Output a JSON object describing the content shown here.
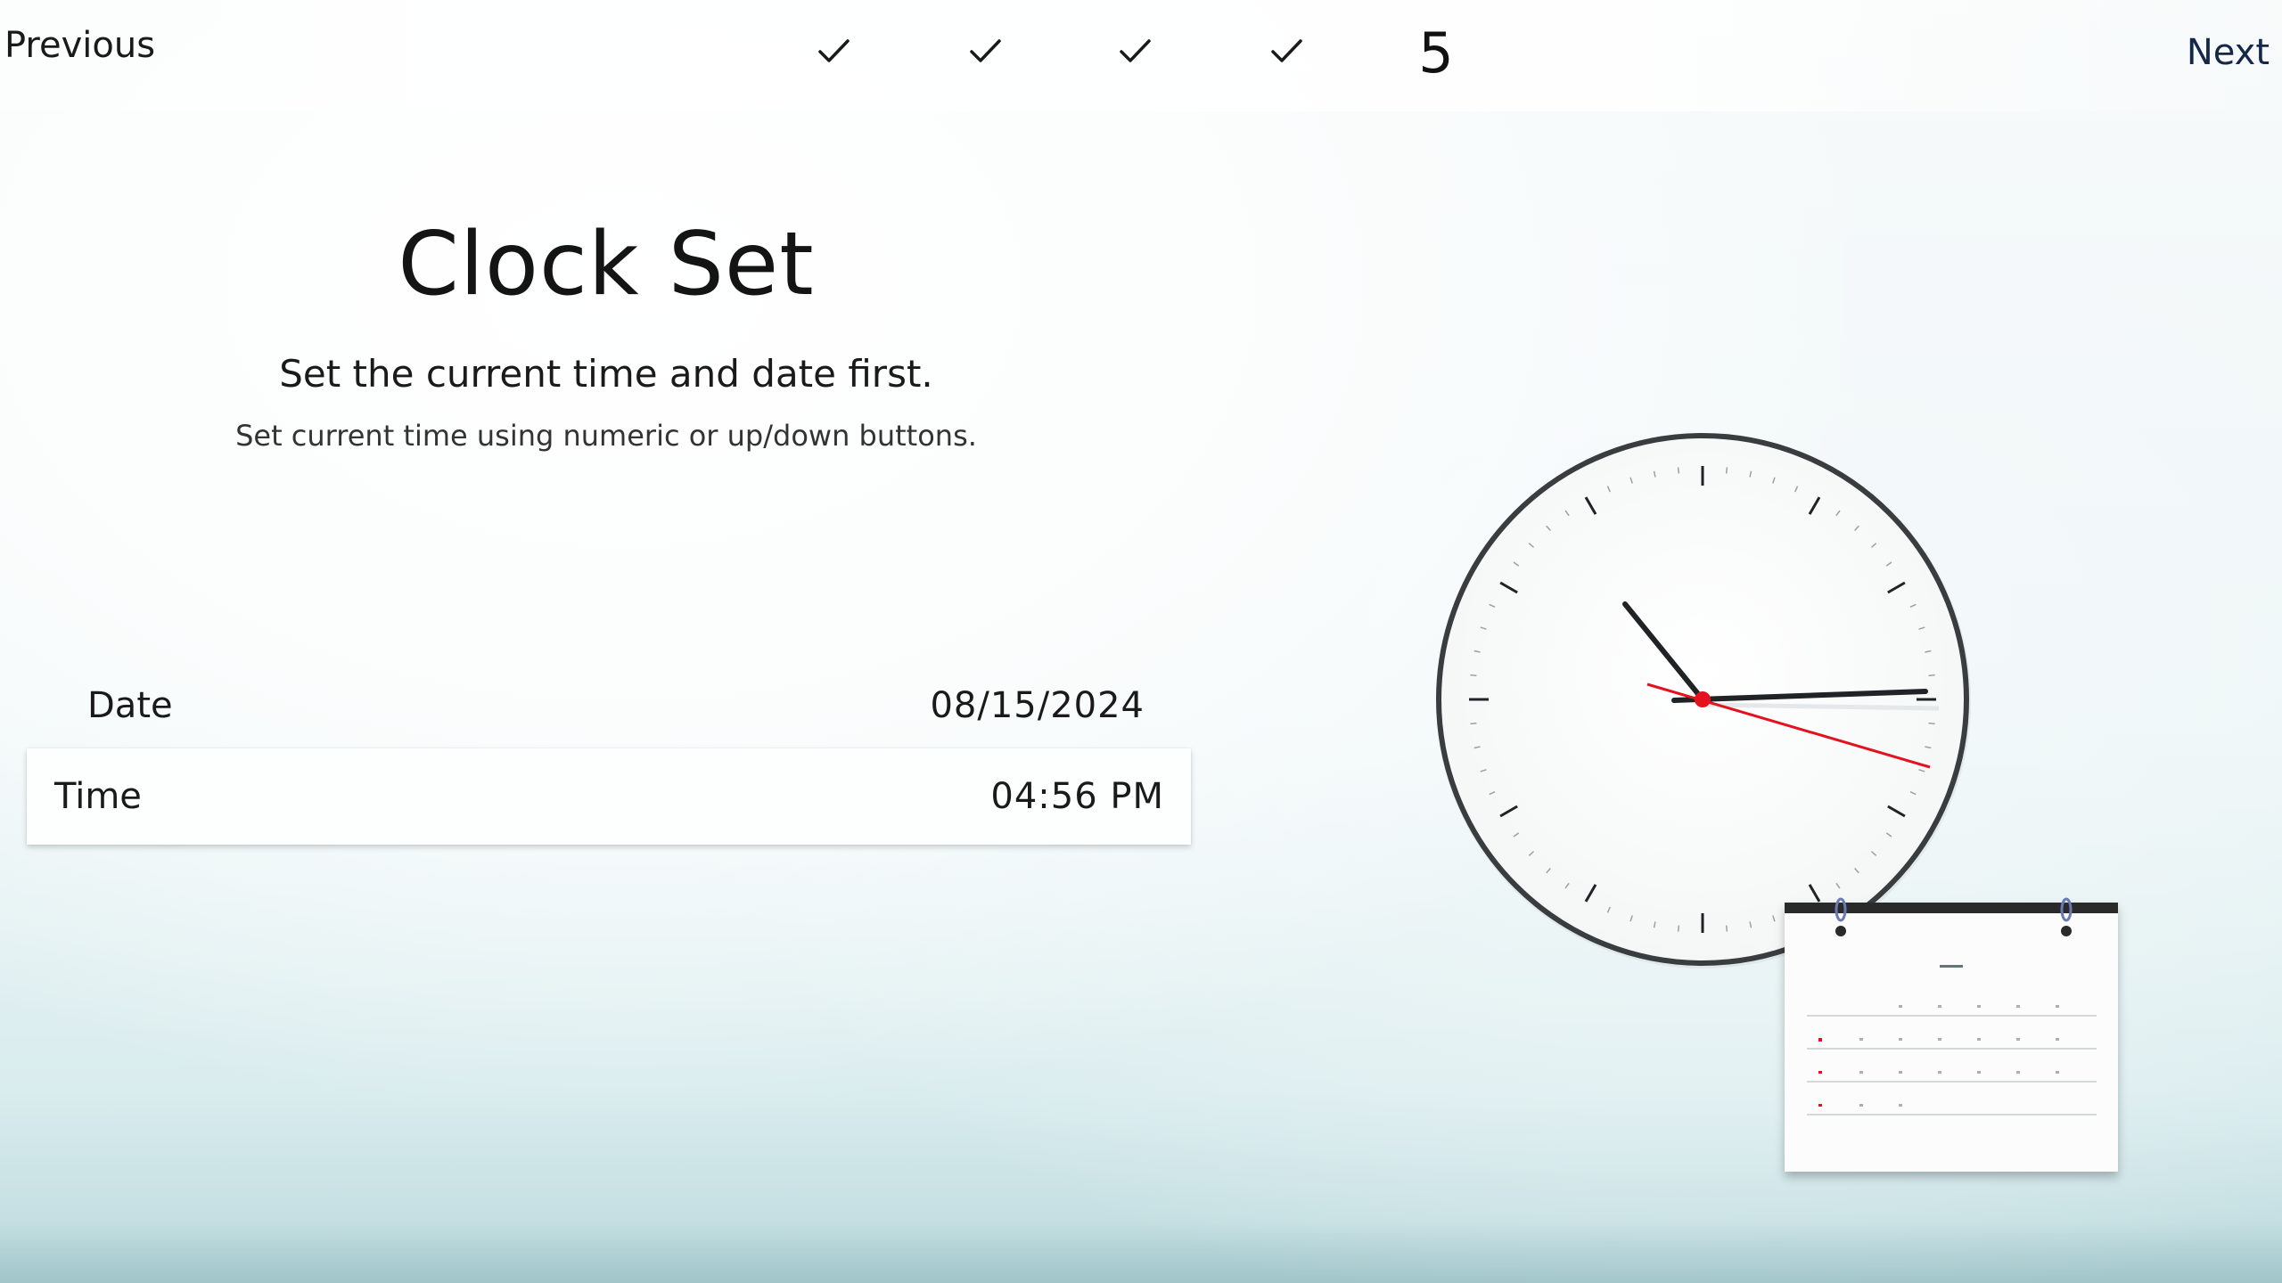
{
  "nav": {
    "previous_label": "Previous",
    "next_label": "Next"
  },
  "steps": {
    "completed": [
      "check-icon",
      "check-icon",
      "check-icon",
      "check-icon"
    ],
    "current": "5"
  },
  "page": {
    "title": "Clock Set",
    "subtitle": "Set the current time and date first.",
    "hint": "Set current time using numeric or up/down buttons."
  },
  "settings": {
    "date": {
      "label": "Date",
      "value": "08/15/2024"
    },
    "time": {
      "label": "Time",
      "value": "04:56 PM"
    }
  },
  "clock": {
    "hour_hand": "hand-icon",
    "accent_color": "#e4111f"
  },
  "colors": {
    "text": "#141414",
    "next_link": "#15284a",
    "second_hand": "#e4111f"
  }
}
